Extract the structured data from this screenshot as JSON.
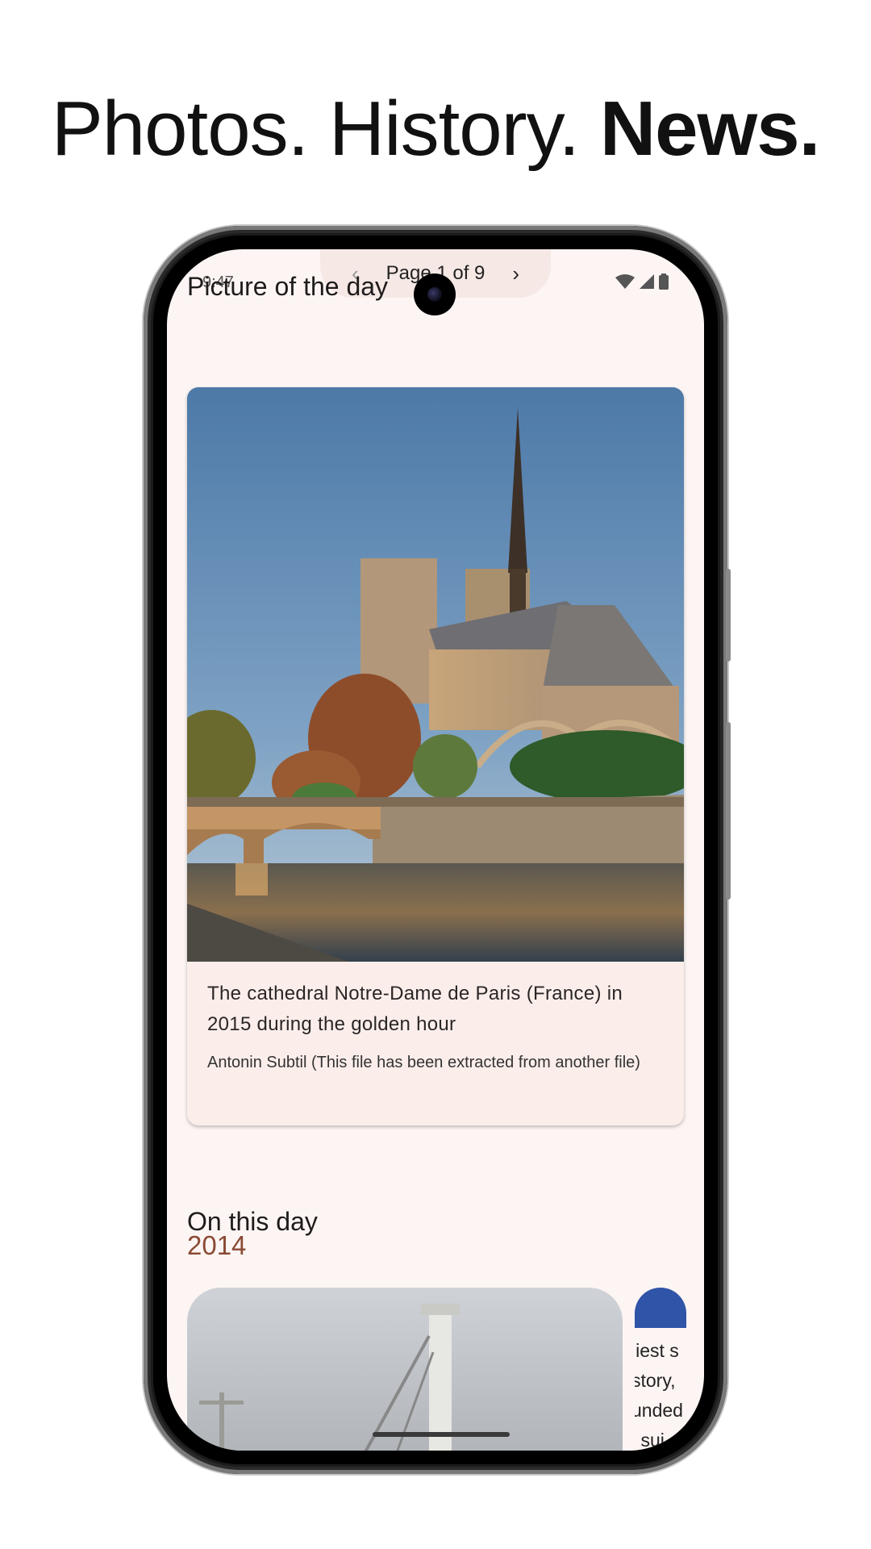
{
  "headline": {
    "part1": "Photos. History. ",
    "part2": "News."
  },
  "status_bar": {
    "time": "9:47",
    "icons": [
      "wifi-icon",
      "cell-signal-icon",
      "battery-icon"
    ]
  },
  "pager": {
    "label": "Page 1 of 9",
    "prev_icon": "chevron-left-icon",
    "next_icon": "chevron-right-icon"
  },
  "picture_of_the_day": {
    "title": "Picture of the day",
    "caption": "The cathedral Notre-Dame de Paris (France) in 2015 during the golden hour",
    "credit": "Antonin Subtil (This file has been extracted from another file)"
  },
  "on_this_day": {
    "title": "On this day",
    "year": "2014",
    "peek_card_lines": [
      "liest s",
      "story,",
      "unded",
      "l sui"
    ]
  },
  "colors": {
    "screen_background": "#fdf5f3",
    "card_background": "#fbeeea",
    "accent_year": "#8a4a34"
  }
}
